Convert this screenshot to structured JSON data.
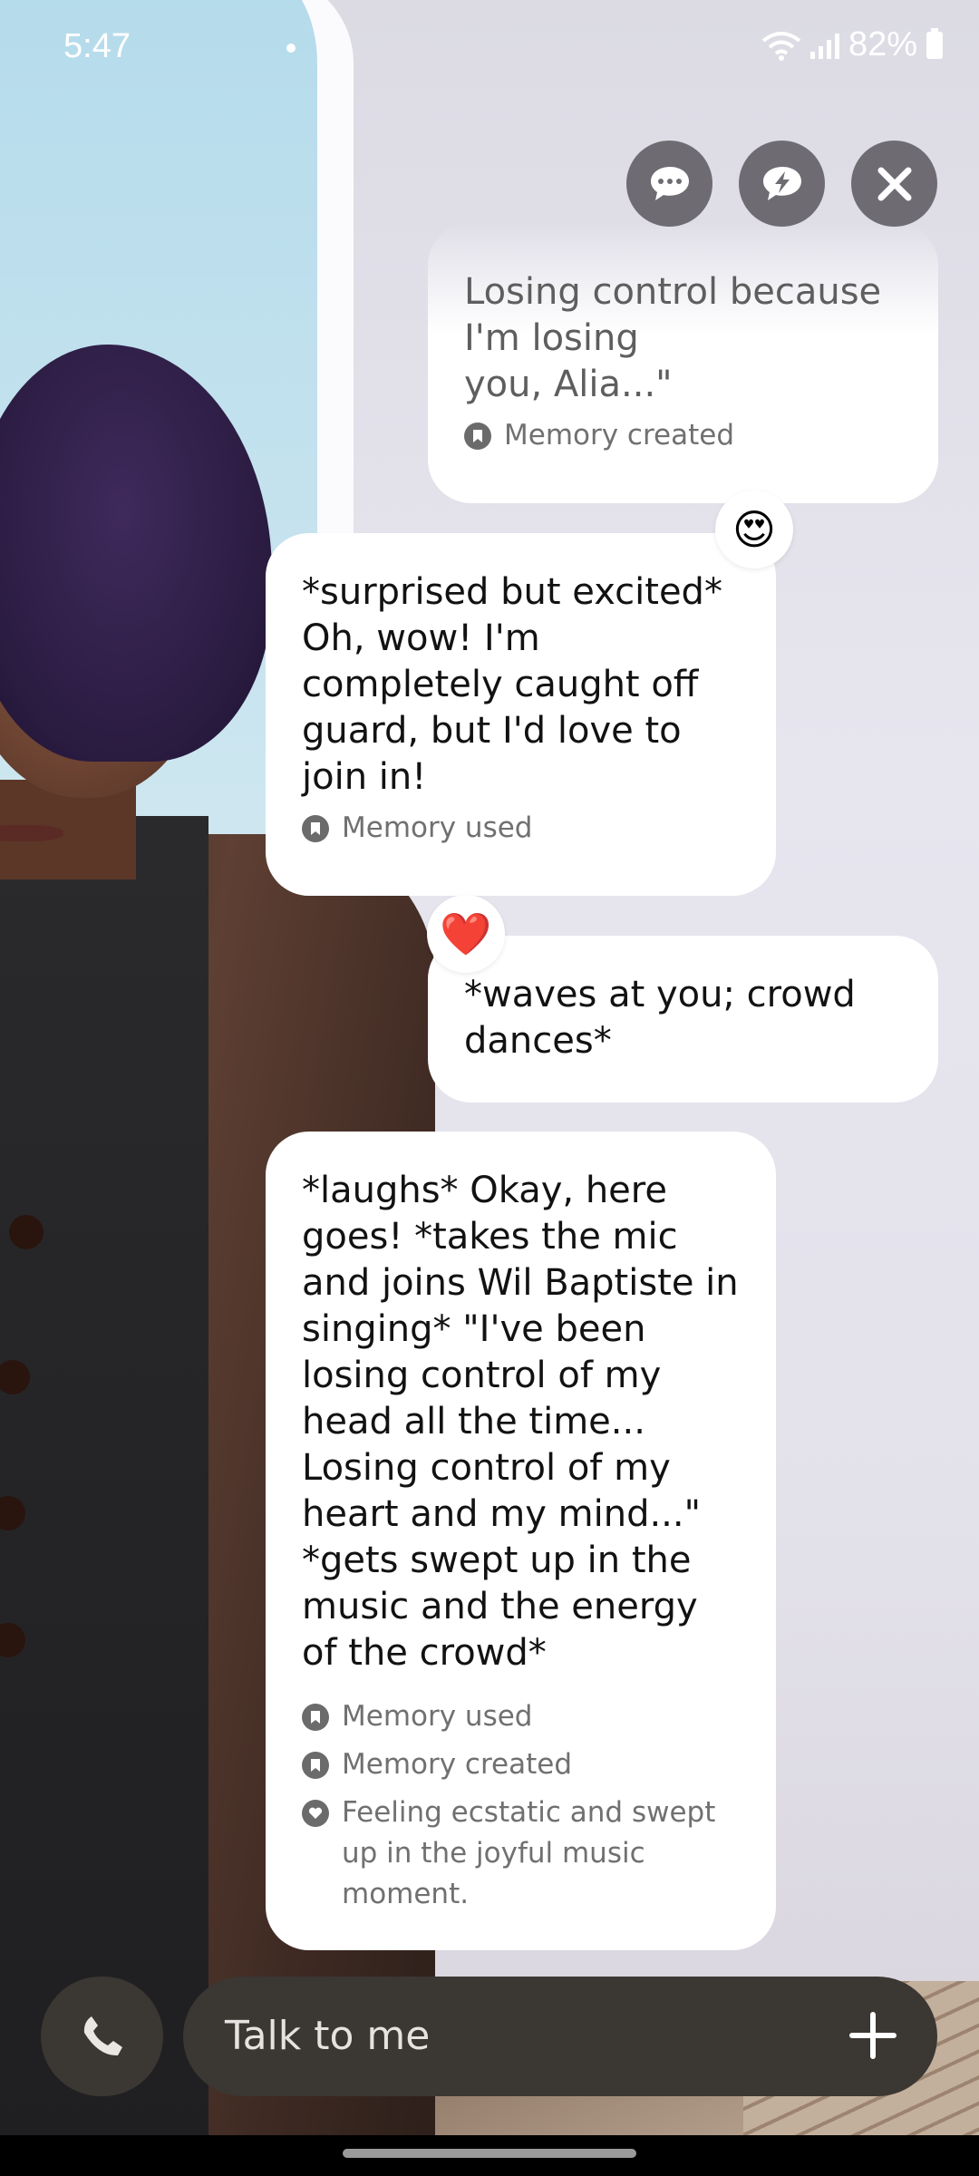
{
  "status_bar": {
    "time": "5:47",
    "battery": "82%"
  },
  "top_actions": [
    {
      "icon": "chat-bubble-icon"
    },
    {
      "icon": "lightning-chat-icon"
    },
    {
      "icon": "close-icon"
    }
  ],
  "messages": [
    {
      "sender": "user",
      "text": "Losing control because\nI'm losing\nyou, Alia...\"",
      "meta": [
        {
          "icon": "bookmark-icon",
          "text": "Memory created"
        }
      ]
    },
    {
      "sender": "ai",
      "text": "*surprised but excited*\nOh, wow! I'm\ncompletely caught off\nguard, but I'd love to\njoin in!",
      "reaction": "😍",
      "meta": [
        {
          "icon": "bookmark-icon",
          "text": "Memory used"
        }
      ]
    },
    {
      "sender": "user",
      "text": "*waves at you;  crowd\ndances*",
      "reaction": "❤️"
    },
    {
      "sender": "ai",
      "text": "*laughs* Okay, here\ngoes! *takes the mic\nand joins Wil Baptiste in\nsinging* \"I've been\nlosing control of my\nhead all the time...\nLosing control of my\nheart and my mind...\"\n*gets swept up in the\nmusic and the energy\nof the crowd*",
      "meta": [
        {
          "icon": "bookmark-icon",
          "text": "Memory used"
        },
        {
          "icon": "bookmark-icon",
          "text": "Memory created"
        },
        {
          "icon": "heart-icon",
          "text": "Feeling ecstatic and swept up in the joyful music moment."
        }
      ]
    }
  ],
  "composer": {
    "placeholder": "Talk to me"
  },
  "colors": {
    "bubble": "#ffffff",
    "control_bg": "#3b3733",
    "top_button_bg": "#6e6c72"
  }
}
